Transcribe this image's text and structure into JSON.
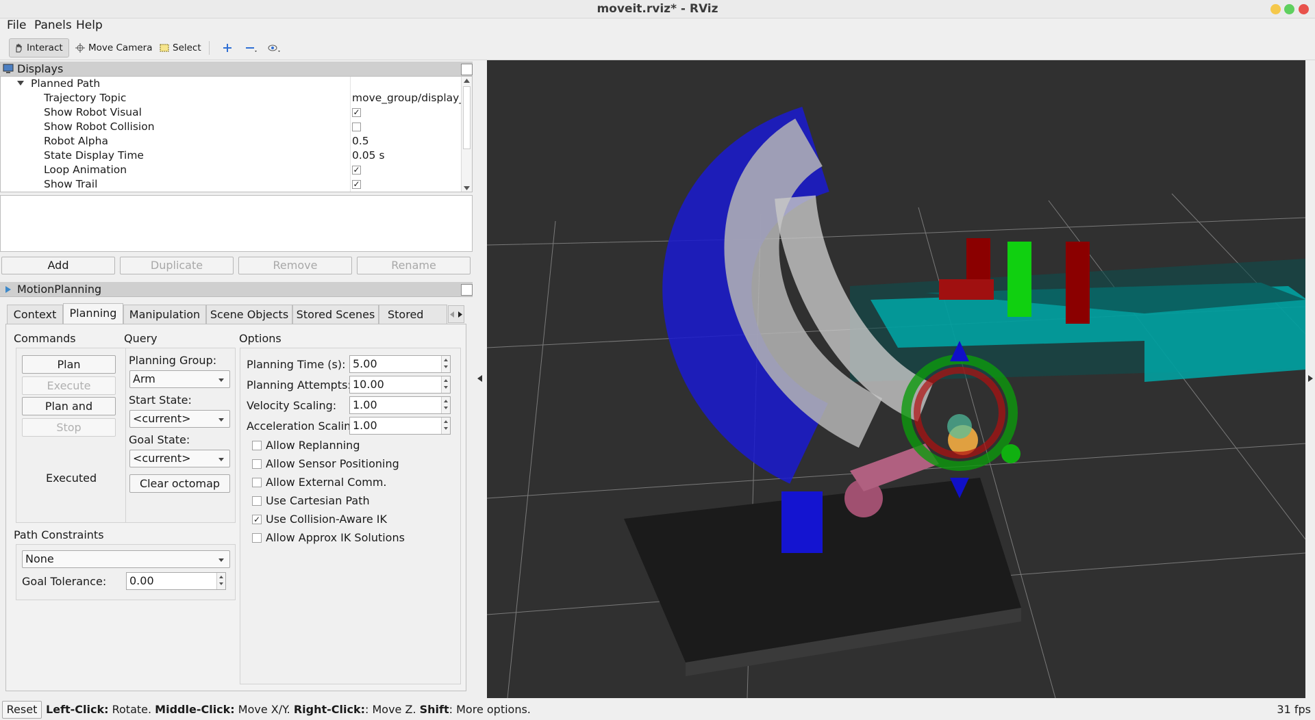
{
  "window": {
    "title": "moveit.rviz* - RViz",
    "btn_colors": [
      "#f5c84b",
      "#5fd05f",
      "#e8524b"
    ]
  },
  "menu": [
    "File",
    "Panels",
    "Help"
  ],
  "toolbar": {
    "interact": "Interact",
    "move_camera": "Move Camera",
    "select": "Select"
  },
  "displays": {
    "title": "Displays",
    "root": "Planned Path",
    "rows": [
      {
        "key": "Trajectory Topic",
        "value": "move_group/display_..."
      },
      {
        "key": "Show Robot Visual",
        "check": "✓"
      },
      {
        "key": "Show Robot Collision",
        "check": ""
      },
      {
        "key": "Robot Alpha",
        "value": "0.5"
      },
      {
        "key": "State Display Time",
        "value": "0.05 s"
      },
      {
        "key": "Loop Animation",
        "check": "✓"
      },
      {
        "key": "Show Trail",
        "check": "✓"
      }
    ],
    "buttons": [
      "Add",
      "Duplicate",
      "Remove",
      "Rename"
    ]
  },
  "motion": {
    "title": "MotionPlanning",
    "tabs": [
      "Context",
      "Planning",
      "Manipulation",
      "Scene Objects",
      "Stored Scenes",
      "Stored Stat"
    ],
    "commands": {
      "label": "Commands",
      "plan": "Plan",
      "execute": "Execute",
      "plan_execute": "Plan and Execute",
      "stop": "Stop",
      "status": "Executed"
    },
    "query": {
      "label": "Query",
      "group_label": "Planning Group:",
      "group": "Arm",
      "start_label": "Start State:",
      "start": "<current>",
      "goal_label": "Goal State:",
      "goal": "<current>",
      "clear": "Clear octomap"
    },
    "options": {
      "label": "Options",
      "fields": [
        {
          "label": "Planning Time (s):",
          "value": "5.00"
        },
        {
          "label": "Planning Attempts:",
          "value": "10.00"
        },
        {
          "label": "Velocity Scaling:",
          "value": "1.00"
        },
        {
          "label": "Acceleration Scaling:",
          "value": "1.00"
        }
      ],
      "checks": [
        {
          "label": "Allow Replanning",
          "mark": ""
        },
        {
          "label": "Allow Sensor Positioning",
          "mark": ""
        },
        {
          "label": "Allow External Comm.",
          "mark": ""
        },
        {
          "label": "Use Cartesian Path",
          "mark": ""
        },
        {
          "label": "Use Collision-Aware IK",
          "mark": "✓"
        },
        {
          "label": "Allow Approx IK Solutions",
          "mark": ""
        }
      ]
    },
    "constraints": {
      "label": "Path Constraints",
      "value": "None",
      "tol_label": "Goal Tolerance:",
      "tol": "0.00"
    }
  },
  "status": {
    "reset": "Reset",
    "h1b": "Left-Click:",
    "h1": " Rotate. ",
    "h2b": "Middle-Click:",
    "h2": " Move X/Y. ",
    "h3b": "Right-Click:",
    "h3": ": Move Z. ",
    "h4b": "Shift",
    "h4": ": More options.",
    "fps": "31 fps"
  }
}
